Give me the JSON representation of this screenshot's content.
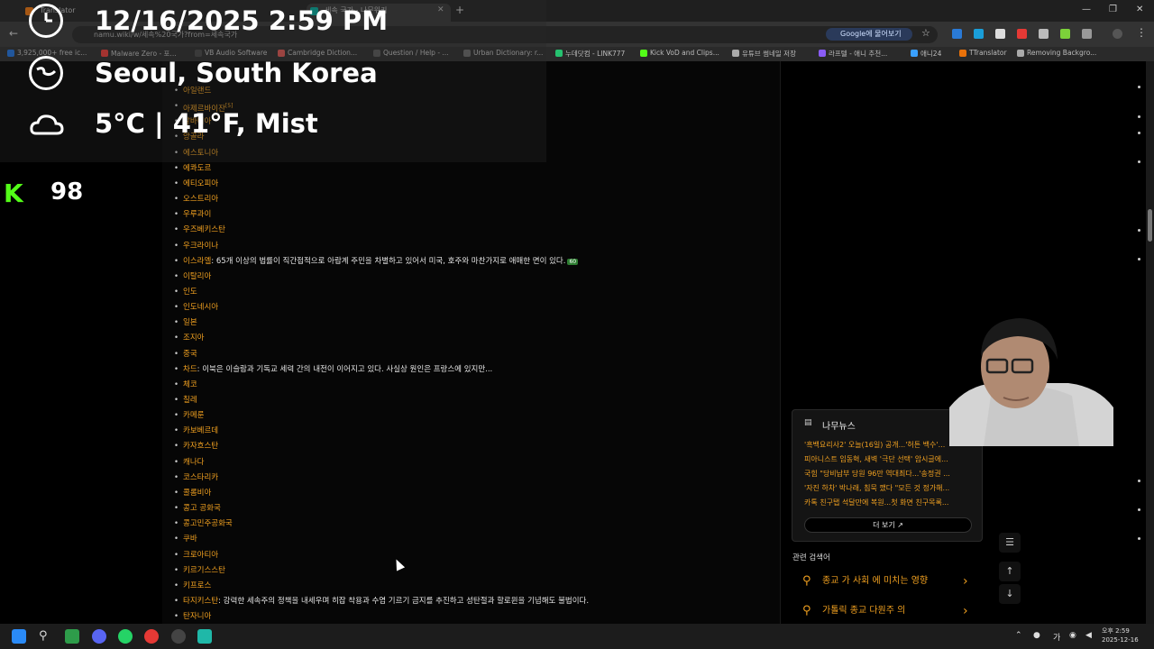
{
  "browser": {
    "tabs": [
      {
        "label": "Translator",
        "color": "#e8710a"
      },
      {
        "label": "세속 국가 - 나무위키",
        "color": "#00a495",
        "active": true
      }
    ],
    "new_tab": "+",
    "window": {
      "minimize": "—",
      "maximize": "❐",
      "close": "✕"
    },
    "url": "namu.wiki/w/세속%20국가?from=세속국가",
    "google_ask": "Google에 물어보기",
    "bookmarks": [
      {
        "label": "3,925,000+ free ic...",
        "color": "#1e6fd9"
      },
      {
        "label": "Malware Zero - 포...",
        "color": "#e53935"
      },
      {
        "label": "VB Audio Software",
        "color": "#444"
      },
      {
        "label": "Cambridge Diction...",
        "color": "#d9534f"
      },
      {
        "label": "Question / Help - ...",
        "color": "#555"
      },
      {
        "label": "Urban Dictionary: r...",
        "color": "#666"
      },
      {
        "label": "누데닷컴 - LINK777",
        "color": "#25c16f"
      },
      {
        "label": "Kick VoD and Clips...",
        "color": "#53fc18"
      },
      {
        "label": "유튜브 썸네일 저장",
        "color": "#aaa"
      },
      {
        "label": "라프텔 - 애니 추천...",
        "color": "#8a5cf6"
      },
      {
        "label": "애니24",
        "color": "#3aa0ff"
      },
      {
        "label": "TTranslator",
        "color": "#e8710a"
      },
      {
        "label": "Removing Backgro...",
        "color": "#aaa"
      }
    ]
  },
  "overlay": {
    "datetime": "12/16/2025 2:59 PM",
    "location": "Seoul, South Korea",
    "weather": "5°C | 41°F, Mist",
    "kick_logo": "K",
    "viewer_count": "98"
  },
  "countries": [
    {
      "name": "아일랜드",
      "note": ""
    },
    {
      "name": "아제르바이잔",
      "sup": "[5]",
      "note": ""
    },
    {
      "name": "알바니아",
      "note": ""
    },
    {
      "name": "앙골라",
      "note": ""
    },
    {
      "name": "에스토니아",
      "note": ""
    },
    {
      "name": "에콰도르",
      "note": ""
    },
    {
      "name": "에티오피아",
      "note": ""
    },
    {
      "name": "오스트리아",
      "note": ""
    },
    {
      "name": "우루과이",
      "note": ""
    },
    {
      "name": "우즈베키스탄",
      "note": ""
    },
    {
      "name": "우크라이나",
      "note": ""
    },
    {
      "name": "이스라엘",
      "note": ": 65개 이상의 법률이 직간접적으로 아랍계 주민을 차별하고 있어서 미국, 호주와 마찬가지로 애매한 면이 있다."
    },
    {
      "name": "이탈리아",
      "note": ""
    },
    {
      "name": "인도",
      "note": ""
    },
    {
      "name": "인도네시아",
      "note": ""
    },
    {
      "name": "일본",
      "note": ""
    },
    {
      "name": "조지아",
      "note": ""
    },
    {
      "name": "중국",
      "note": ""
    },
    {
      "name": "차드",
      "note": ": 이북은 이슬람과 기독교 세력 간의 내전이 이어지고 있다. 사실상 원인은 프랑스에 있지만..."
    },
    {
      "name": "체코",
      "note": ""
    },
    {
      "name": "칠레",
      "note": ""
    },
    {
      "name": "카메룬",
      "note": ""
    },
    {
      "name": "카보베르데",
      "note": ""
    },
    {
      "name": "카자흐스탄",
      "note": ""
    },
    {
      "name": "캐나다",
      "note": ""
    },
    {
      "name": "코스타리카",
      "note": ""
    },
    {
      "name": "콜롬비아",
      "note": ""
    },
    {
      "name": "콩고 공화국",
      "note": ""
    },
    {
      "name": "콩고민주공화국",
      "note": ""
    },
    {
      "name": "쿠바",
      "note": ""
    },
    {
      "name": "크로아티아",
      "note": ""
    },
    {
      "name": "키르기스스탄",
      "note": ""
    },
    {
      "name": "키프로스",
      "note": ""
    },
    {
      "name": "타지키스탄",
      "note": ": 강력한 세속주의 정책을 내세우며 히잡 착용과 수염 기르기 금지를 추진하고 성탄절과 할로윈을 기념해도 불법이다."
    },
    {
      "name": "탄자니아",
      "note": ""
    }
  ],
  "israel_badge": "60",
  "news": {
    "title": "나무뉴스",
    "items": [
      "'흑백요리사2' 오늘(16일) 공개...'허튼 백수'...",
      "피아니스트 임동혁, 새벽 '극단 선택' 암시글에...",
      "국힘 \"당비납부 당원 96만 역대최다...'송정권 ...",
      "'자진 하차' 박나래, 침묵 깼다 \"모든 것 정가해...",
      "카톡 친구탭 석달만에 복원...첫 화면 친구목록..."
    ],
    "more": "더 보기"
  },
  "related": {
    "label": "관련 검색어",
    "items": [
      "종교 가 사회 에 미치는 영향",
      "가톨릭 종교 다원주 의"
    ]
  },
  "float_buttons": {
    "toc": "☰",
    "up": "↑",
    "down": "↓"
  },
  "taskbar": {
    "ime": "가",
    "time": "오후 2:59",
    "date": "2025-12-16"
  }
}
